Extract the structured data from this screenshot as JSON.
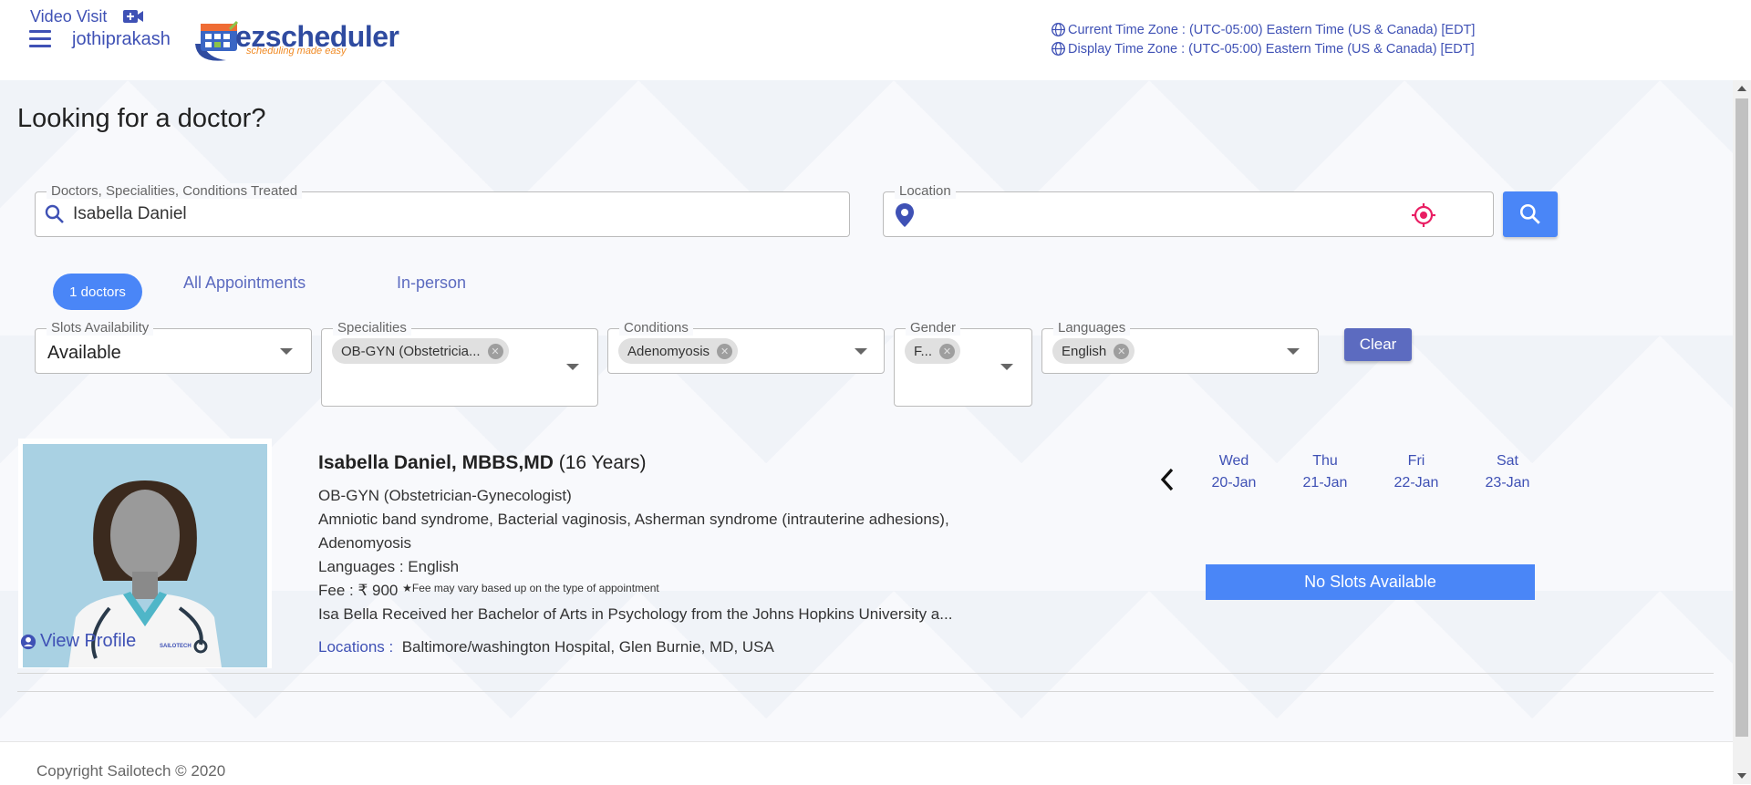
{
  "header": {
    "username": "jothiprakash",
    "logo": {
      "brand": "ezscheduler",
      "tagline": "scheduling made easy"
    },
    "current_tz": "Current Time Zone : (UTC-05:00) Eastern Time (US & Canada) [EDT]",
    "display_tz": "Display Time Zone : (UTC-05:00) Eastern Time (US & Canada) [EDT]"
  },
  "page": {
    "title": "Looking for a doctor?"
  },
  "search": {
    "label": "Doctors, Specialities, Conditions Treated",
    "value": "Isabella Daniel",
    "location_label": "Location",
    "location_value": ""
  },
  "tabs": {
    "count": "1 doctors",
    "all": "All Appointments",
    "in_person": "In-person",
    "video": "Video Visit"
  },
  "filters": {
    "slots": {
      "label": "Slots Availability",
      "value": "Available"
    },
    "specialities": {
      "label": "Specialities",
      "chip": "OB-GYN (Obstetricia..."
    },
    "conditions": {
      "label": "Conditions",
      "chip": "Adenomyosis"
    },
    "gender": {
      "label": "Gender",
      "chip": "F..."
    },
    "languages": {
      "label": "Languages",
      "chip": "English"
    },
    "clear": "Clear"
  },
  "doctor": {
    "name": "Isabella Daniel, MBBS,MD",
    "years": "(16 Years)",
    "specialty": "OB-GYN (Obstetrician-Gynecologist)",
    "conditions_line1": "Amniotic band syndrome, Bacterial vaginosis, Asherman syndrome (intrauterine adhesions),",
    "conditions_line2": "Adenomyosis",
    "languages": "Languages : English",
    "fee": "Fee : ₹ 900",
    "fee_note": "★Fee may vary based up on the type of appointment",
    "bio": "Isa Bella Received her Bachelor of Arts in Psychology from the Johns Hopkins University a...",
    "locations_label": "Locations :",
    "locations": "Baltimore/washington Hospital, Glen Burnie, MD, USA",
    "view_profile": "View Profile",
    "photo_watermark": "SAILOTECH"
  },
  "calendar": {
    "days": [
      {
        "dow": "Wed",
        "date": "20-Jan"
      },
      {
        "dow": "Thu",
        "date": "21-Jan"
      },
      {
        "dow": "Fri",
        "date": "22-Jan"
      },
      {
        "dow": "Sat",
        "date": "23-Jan"
      }
    ],
    "no_slots": "No Slots Available"
  },
  "footer": {
    "copyright": "Copyright Sailotech © 2020"
  },
  "colors": {
    "accent": "#3f51b5",
    "primary_button": "#4a86f7",
    "tab_underline": "#e91e63"
  }
}
